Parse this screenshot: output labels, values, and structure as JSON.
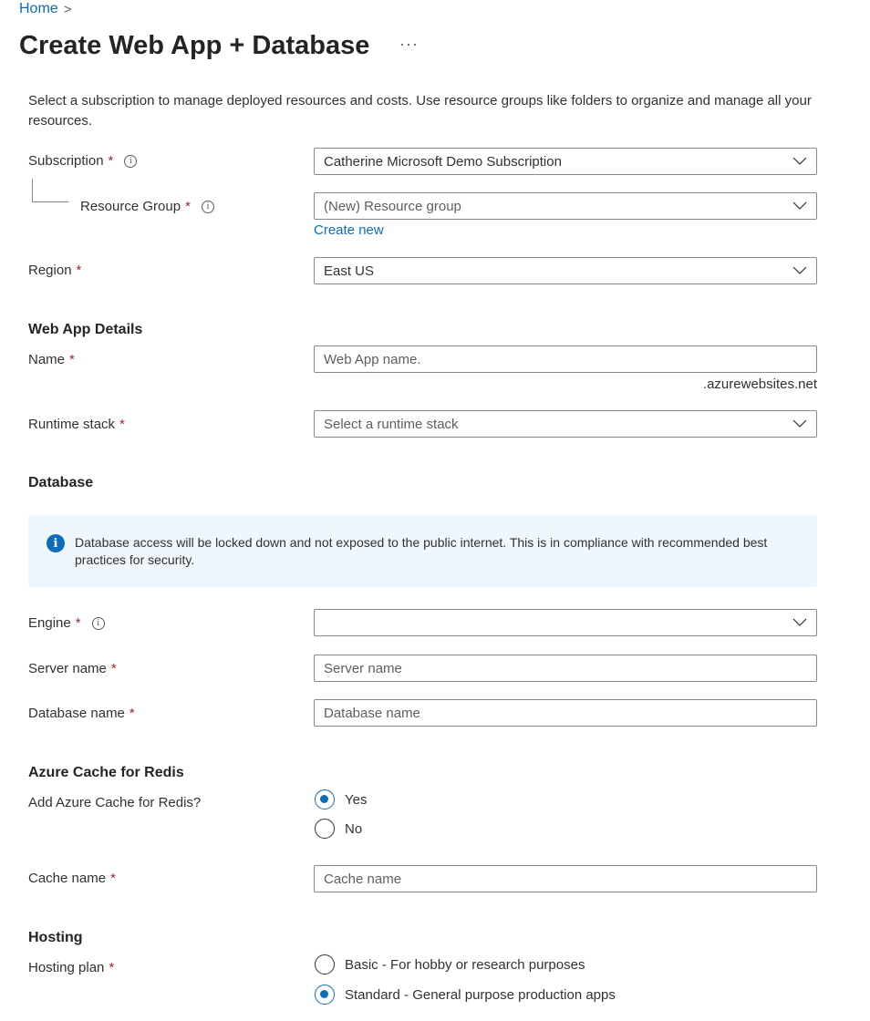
{
  "breadcrumb": {
    "home": "Home",
    "separator": ">"
  },
  "page": {
    "title": "Create Web App + Database",
    "more": "···"
  },
  "intro": "Select a subscription to manage deployed resources and costs. Use resource groups like folders to organize and manage all your resources.",
  "project": {
    "subscription": {
      "label": "Subscription",
      "value": "Catherine Microsoft Demo Subscription"
    },
    "resource_group": {
      "label": "Resource Group",
      "value": "(New) Resource group",
      "create_new": "Create new"
    },
    "region": {
      "label": "Region",
      "value": "East US"
    }
  },
  "web_app": {
    "heading": "Web App Details",
    "name": {
      "label": "Name",
      "placeholder": "Web App name.",
      "suffix": ".azurewebsites.net"
    },
    "runtime": {
      "label": "Runtime stack",
      "placeholder": "Select a runtime stack"
    }
  },
  "database": {
    "heading": "Database",
    "banner": "Database access will be locked down and not exposed to the public internet. This is in compliance with recommended best practices for security.",
    "engine": {
      "label": "Engine",
      "value": ""
    },
    "server_name": {
      "label": "Server name",
      "placeholder": "Server name"
    },
    "database_name": {
      "label": "Database name",
      "placeholder": "Database name"
    }
  },
  "redis": {
    "heading": "Azure Cache for Redis",
    "question": "Add Azure Cache for Redis?",
    "options": [
      {
        "label": "Yes",
        "checked": true
      },
      {
        "label": "No",
        "checked": false
      }
    ],
    "cache_name": {
      "label": "Cache name",
      "placeholder": "Cache name"
    }
  },
  "hosting": {
    "heading": "Hosting",
    "plan_label": "Hosting plan",
    "options": [
      {
        "label": "Basic - For hobby or research purposes",
        "checked": false
      },
      {
        "label": "Standard - General purpose production apps",
        "checked": true
      }
    ]
  },
  "required_marker": "*",
  "info_glyph": "i",
  "colors": {
    "accent": "#0f6cbd",
    "required": "#a4262c",
    "banner_bg": "#eff6fc",
    "border": "#8a8886"
  }
}
